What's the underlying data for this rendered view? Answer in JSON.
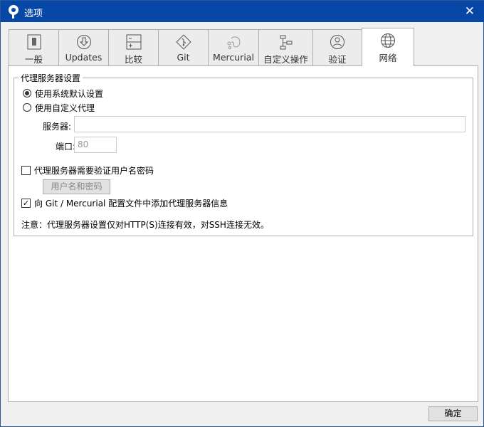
{
  "window": {
    "title": "选项",
    "close_icon": "close-icon"
  },
  "tabs": [
    {
      "label": "一般",
      "icon": "switch-icon"
    },
    {
      "label": "Updates",
      "icon": "download-circle-icon"
    },
    {
      "label": "比较",
      "icon": "diff-icon"
    },
    {
      "label": "Git",
      "icon": "git-icon"
    },
    {
      "label": "Mercurial",
      "icon": "mercurial-icon"
    },
    {
      "label": "自定义操作",
      "icon": "flow-icon"
    },
    {
      "label": "验证",
      "icon": "user-circle-icon"
    },
    {
      "label": "网络",
      "icon": "globe-icon",
      "selected": true
    }
  ],
  "proxy": {
    "group_title": "代理服务器设置",
    "radio_system": "使用系统默认设置",
    "radio_custom": "使用自定义代理",
    "selected": "system",
    "server_label": "服务器:",
    "server_value": "",
    "port_label": "端口:",
    "port_value": "80",
    "auth_checkbox": "代理服务器需要验证用户名密码",
    "auth_checked": false,
    "credentials_button": "用户名和密码",
    "add_to_config_checkbox": "向 Git / Mercurial 配置文件中添加代理服务器信息",
    "add_to_config_checked": true,
    "note": "注意：代理服务器设置仅对HTTP(S)连接有效，对SSH连接无效。"
  },
  "footer": {
    "ok_button": "确定"
  }
}
